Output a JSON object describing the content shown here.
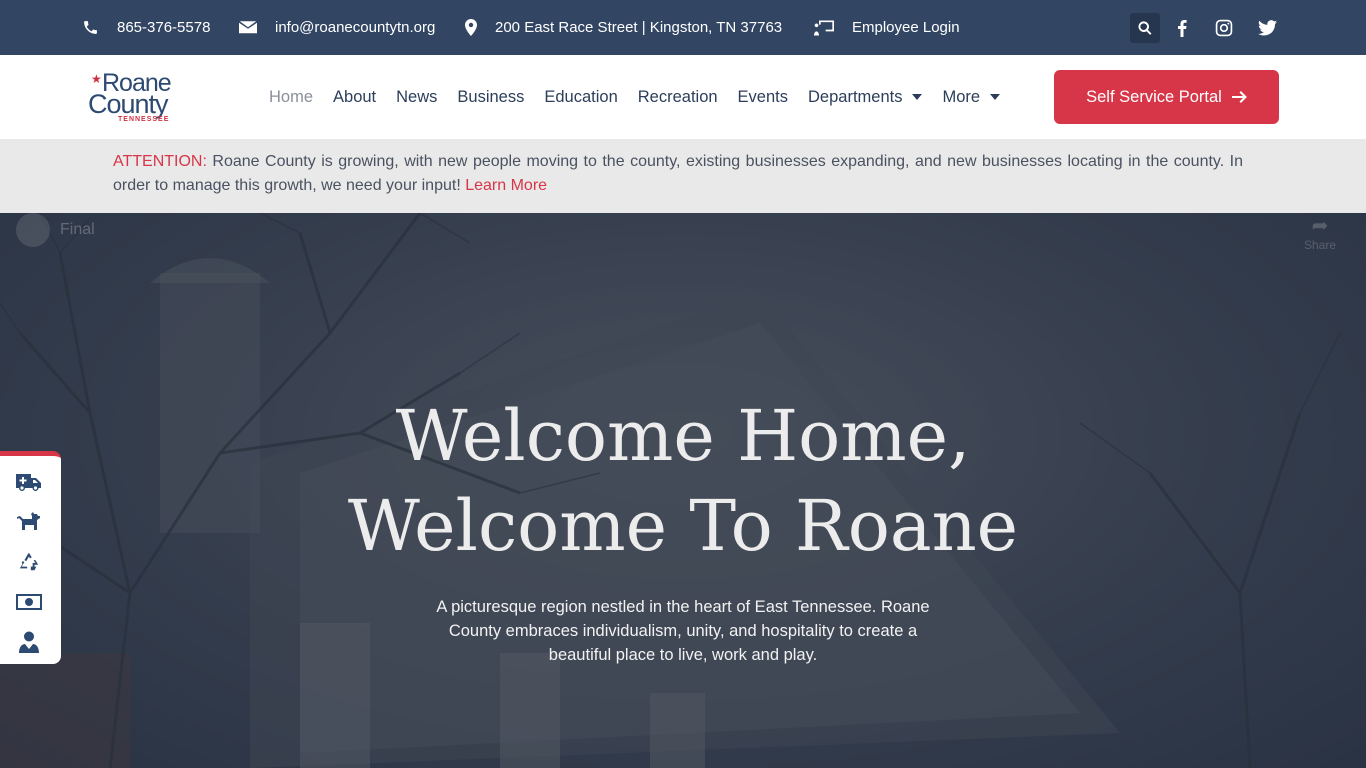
{
  "topbar": {
    "phone": "865-376-5578",
    "email": "info@roanecountytn.org",
    "address": "200 East Race Street | Kingston, TN 37763",
    "employee_login": "Employee Login"
  },
  "logo": {
    "line1": "Roane",
    "line2": "County",
    "line3": "TENNESSEE"
  },
  "nav": {
    "items": [
      "Home",
      "About",
      "News",
      "Business",
      "Education",
      "Recreation",
      "Events",
      "Departments",
      "More"
    ],
    "active": "Home",
    "cta": "Self Service Portal"
  },
  "attention": {
    "label": "ATTENTION:",
    "text": "Roane County is growing, with new people moving to the county, existing businesses expanding, and new businesses locating in the county. In order to manage this growth, we need your input!",
    "link": "Learn More"
  },
  "hero": {
    "video_title": "Final",
    "share_label": "Share",
    "title_line1": "Welcome Home,",
    "title_line2": "Welcome To Roane",
    "subtitle": "A picturesque region nestled in the heart of East Tennessee. Roane County embraces individualism, unity, and hospitality to create a beautiful place to live, work and play."
  },
  "sidebar_icons": [
    "ambulance-icon",
    "dog-icon",
    "recycle-icon",
    "money-bill-icon",
    "user-tie-icon"
  ],
  "colors": {
    "topbar": "#324663",
    "accent": "#d73648",
    "navy": "#2c4a72"
  }
}
